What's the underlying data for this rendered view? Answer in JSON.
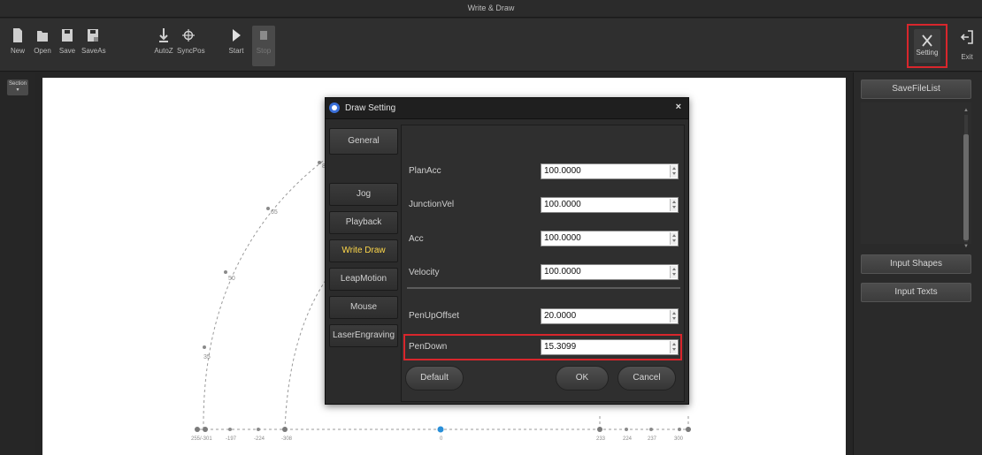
{
  "window": {
    "title": "Write & Draw"
  },
  "toolbar": {
    "buttons": [
      {
        "label": "New",
        "icon": "new-file-icon"
      },
      {
        "label": "Open",
        "icon": "folder-open-icon"
      },
      {
        "label": "Save",
        "icon": "save-icon"
      },
      {
        "label": "SaveAs",
        "icon": "save-as-icon"
      },
      {
        "label": "AutoZ",
        "icon": "auto-z-icon"
      },
      {
        "label": "SyncPos",
        "icon": "sync-position-icon"
      },
      {
        "label": "Start",
        "icon": "play-icon"
      },
      {
        "label": "Stop",
        "icon": "stop-icon",
        "disabled": true
      }
    ],
    "setting_label": "Setting",
    "exit_label": "Exit"
  },
  "left_panel": {
    "section_label": "Section ▾"
  },
  "canvas": {
    "point_labels": [
      "80",
      "65",
      "50",
      "35"
    ],
    "axis_labels": [
      "255/-301",
      "-197",
      "-224",
      "-308",
      "0",
      "233",
      "224",
      "237",
      "300"
    ]
  },
  "right_panel": {
    "save_file_list_label": "SaveFileList",
    "input_shapes_label": "Input Shapes",
    "input_texts_label": "Input Texts"
  },
  "dialog": {
    "title": "Draw Setting",
    "close_glyph": "×",
    "tabs": [
      {
        "label": "General"
      },
      {
        "label": "Jog"
      },
      {
        "label": "Playback"
      },
      {
        "label": "Write  Draw",
        "active": true
      },
      {
        "label": "LeapMotion"
      },
      {
        "label": "Mouse"
      },
      {
        "label": "LaserEngraving"
      }
    ],
    "fields": {
      "plan_acc": {
        "label": "PlanAcc",
        "value": "100.0000"
      },
      "junction_vel": {
        "label": "JunctionVel",
        "value": "100.0000"
      },
      "acc": {
        "label": "Acc",
        "value": "100.0000"
      },
      "velocity": {
        "label": "Velocity",
        "value": "100.0000"
      },
      "pen_up_offset": {
        "label": "PenUpOffset",
        "value": "20.0000"
      },
      "pen_down": {
        "label": "PenDown",
        "value": "15.3099"
      }
    },
    "buttons": {
      "default": "Default",
      "ok": "OK",
      "cancel": "Cancel"
    }
  },
  "colors": {
    "highlight_red": "#d8262c",
    "active_tab_yellow": "#ffd84a",
    "canvas_bg": "#ffffff",
    "origin_blue": "#2a8fd8"
  }
}
